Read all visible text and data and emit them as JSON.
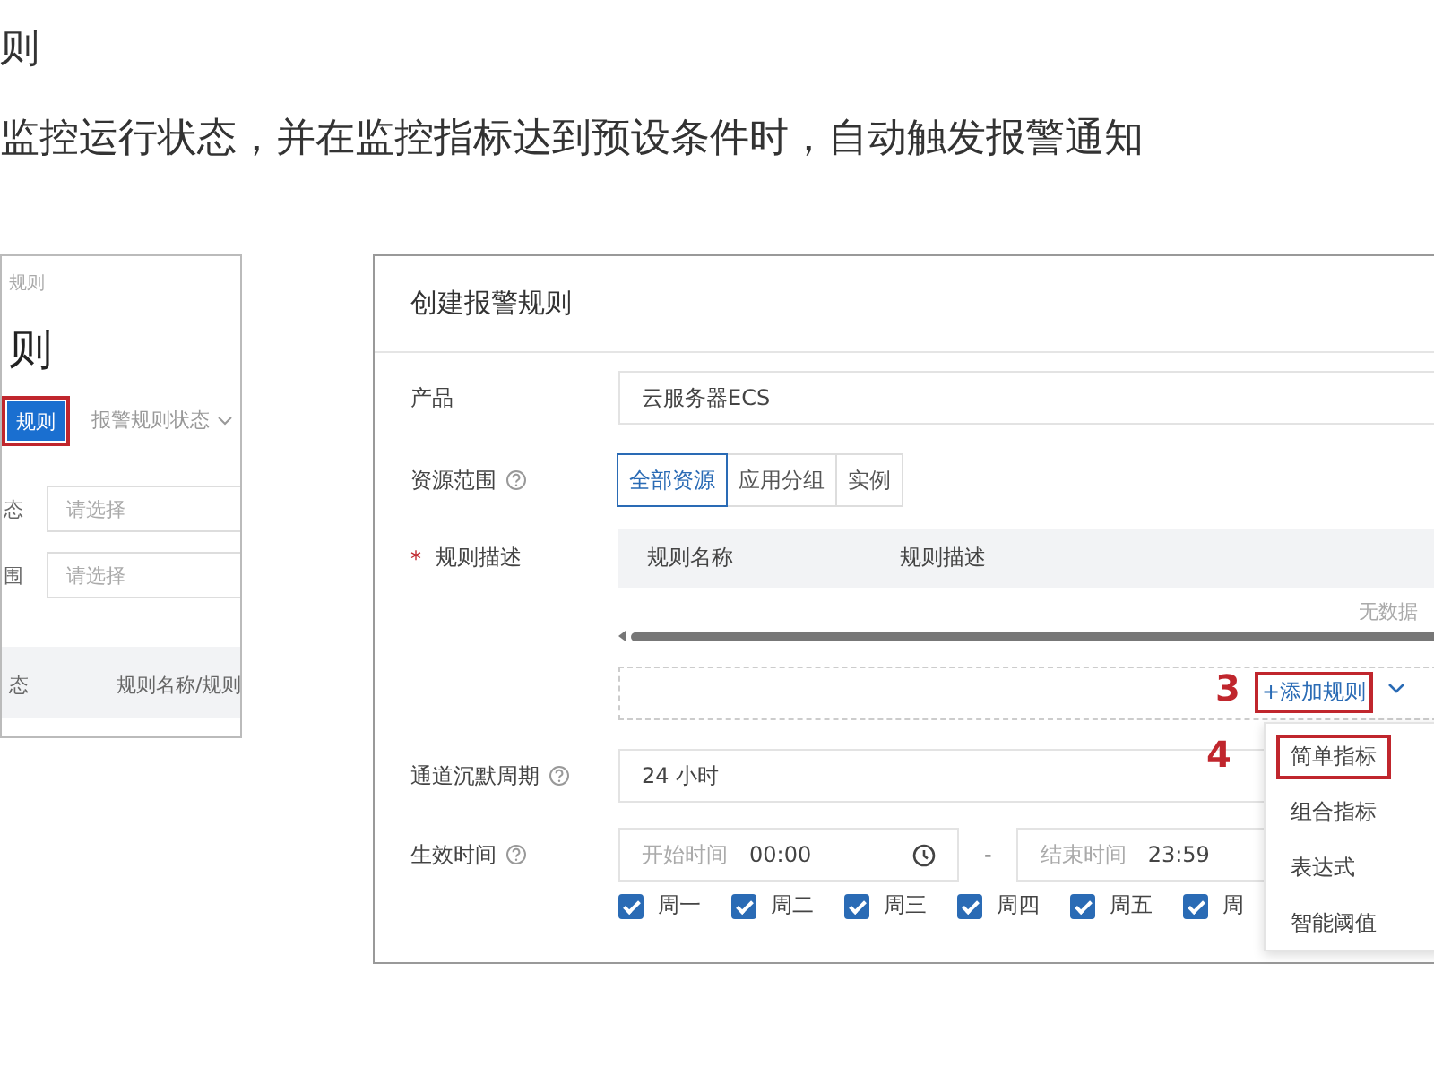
{
  "heading": "则",
  "intro": "监控运行状态，并在监控指标达到预设条件时，自动触发报警通知",
  "left_panel": {
    "breadcrumb": "规则",
    "title": "则",
    "create_button": {
      "label": "规则",
      "highlighted": true
    },
    "status_filter": "报警规则状态",
    "filters": [
      {
        "label": "态",
        "placeholder": "请选择"
      },
      {
        "label": "围",
        "placeholder": "请选择"
      }
    ],
    "columns": [
      "态",
      "规则名称/规则"
    ]
  },
  "dialog": {
    "title": "创建报警规则",
    "product": {
      "label": "产品",
      "value": "云服务器ECS"
    },
    "scope": {
      "label": "资源范围",
      "options": [
        {
          "label": "全部资源",
          "selected": true
        },
        {
          "label": "应用分组",
          "selected": false
        },
        {
          "label": "实例",
          "selected": false
        }
      ]
    },
    "rules": {
      "required_mark": "*",
      "label": "规则描述",
      "columns": [
        "规则名称",
        "规则描述"
      ],
      "empty": "无数据",
      "add_button": {
        "label": "+添加规则",
        "highlighted": true
      },
      "callout": "3"
    },
    "silence": {
      "label": "通道沉默周期",
      "value": "24 小时"
    },
    "effective": {
      "label": "生效时间",
      "start_label": "开始时间",
      "start": "00:00",
      "separator": "-",
      "end_label": "结束时间",
      "end": "23:59",
      "days": [
        {
          "label": "周一",
          "checked": true
        },
        {
          "label": "周二",
          "checked": true
        },
        {
          "label": "周三",
          "checked": true
        },
        {
          "label": "周四",
          "checked": true
        },
        {
          "label": "周五",
          "checked": true
        },
        {
          "label": "周",
          "checked": true
        }
      ]
    },
    "menu": {
      "callout": "4",
      "items": [
        {
          "label": "简单指标",
          "highlighted": true
        },
        {
          "label": "组合指标",
          "highlighted": false
        },
        {
          "label": "表达式",
          "highlighted": false
        },
        {
          "label": "智能阈值",
          "highlighted": false
        }
      ]
    }
  }
}
